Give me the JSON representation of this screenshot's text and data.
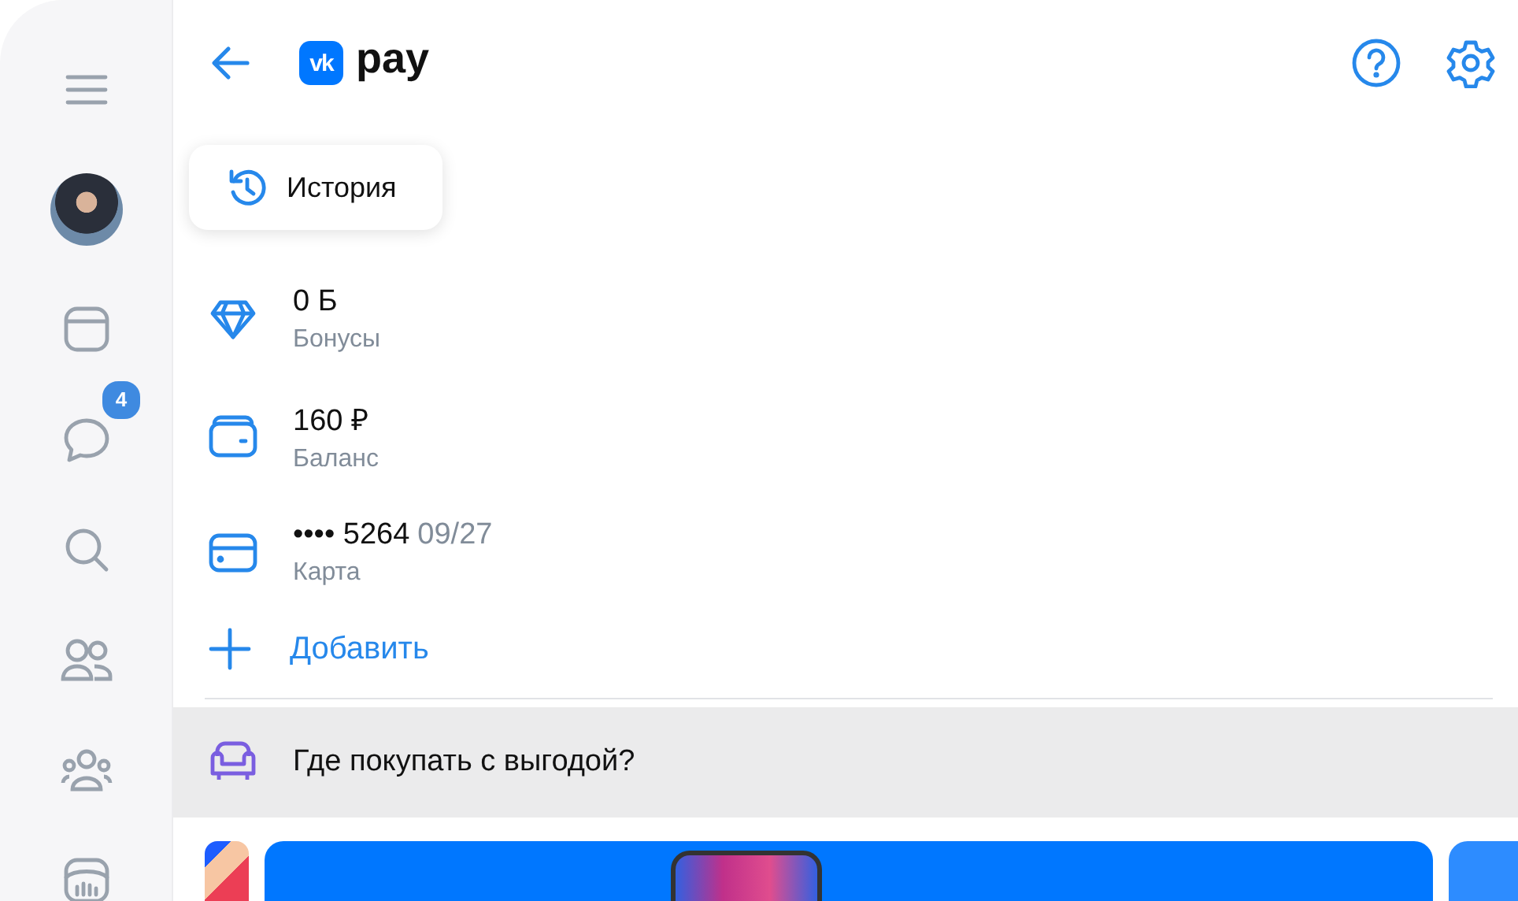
{
  "sidebar": {
    "items": [
      {
        "kind": "menu"
      },
      {
        "kind": "avatar"
      },
      {
        "kind": "window"
      },
      {
        "kind": "chat",
        "badge": "4"
      },
      {
        "kind": "search"
      },
      {
        "kind": "friends"
      },
      {
        "kind": "groups"
      },
      {
        "kind": "stats"
      }
    ]
  },
  "header": {
    "logo": {
      "mark": "vk",
      "name": "pay"
    }
  },
  "history_button": {
    "label": "История"
  },
  "accounts": [
    {
      "kind": "bonus",
      "value": "0 Б",
      "label": "Бонусы"
    },
    {
      "kind": "wallet",
      "value": "160 ₽",
      "label": "Баланс"
    },
    {
      "kind": "card",
      "value": "•••• 5264",
      "expiry": "09/27",
      "label": "Карта"
    }
  ],
  "add_button": {
    "label": "Добавить"
  },
  "promo": {
    "label": "Где покупать с выгодой?"
  }
}
